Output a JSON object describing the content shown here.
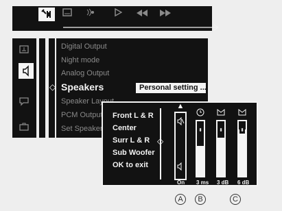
{
  "toolbar": {
    "settings_icon": "wrench-and-audio-icon",
    "icons": [
      "subtitle-icon",
      "audio-language-icon",
      "play-icon",
      "rewind-icon",
      "fast-forward-icon"
    ]
  },
  "sidebar": {
    "icons": [
      "disc-icon",
      "speaker-icon",
      "subtitle-chat-icon",
      "briefcase-icon"
    ],
    "selected": "speaker-icon"
  },
  "menu": {
    "items": [
      "Digital Output",
      "Night mode",
      "Analog Output",
      "Speakers",
      "Speaker Layout",
      "PCM Output",
      "Set Speaker"
    ],
    "selected_index": 3,
    "selected_value": "Personal setting ..."
  },
  "dialog": {
    "items": [
      "Front L & R",
      "Center",
      "Surr L & R",
      "Sub Woofer",
      "OK to exit"
    ],
    "sliders": [
      {
        "icon": "speaker-mute-icon",
        "value": "On"
      },
      {
        "icon": "clock-delay-icon",
        "value": "3 ms",
        "level": 0.55
      },
      {
        "icon": "bowtie-speaker-icon",
        "value": "3 dB",
        "level": 0.7
      },
      {
        "icon": "bowtie-speaker-icon",
        "value": "6 dB",
        "level": 0.85
      }
    ]
  },
  "callouts": [
    "A",
    "B",
    "C"
  ]
}
